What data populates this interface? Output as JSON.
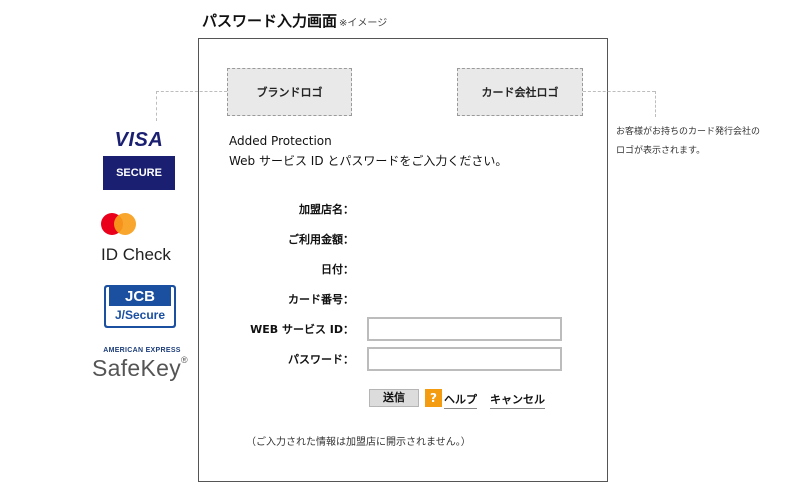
{
  "header": {
    "title": "パスワード入力画面",
    "note": "※イメージ"
  },
  "logo_placeholders": {
    "brand": "ブランドロゴ",
    "card_company": "カード会社ロゴ"
  },
  "side_note": {
    "line1": "お客様がお持ちのカード発行会社の",
    "line2": "ロゴが表示されます。"
  },
  "brand_logos": {
    "visa": {
      "word": "VISA",
      "sub": "SECURE"
    },
    "mastercard": {
      "text": "ID Check"
    },
    "jcb": {
      "word": "JCB",
      "sub": "J/Secure"
    },
    "amex": {
      "top": "AMERICAN EXPRESS",
      "main": "SafeKey",
      "mark": "®"
    }
  },
  "form": {
    "intro_line1": "Added Protection",
    "intro_line2": "Web サービス ID とパスワードをご入力ください。",
    "fields": {
      "merchant": "加盟店名：",
      "amount": "ご利用金額：",
      "date": "日付：",
      "card_number": "カード番号：",
      "web_service_id": "WEB サービス ID：",
      "password": "パスワード："
    },
    "web_service_id_value": "",
    "password_value": "",
    "buttons": {
      "send": "送信",
      "help_icon": "?",
      "help": "ヘルプ",
      "cancel": "キャンセル"
    },
    "footnote": "（ご入力された情報は加盟店に開示されません。）"
  },
  "colors": {
    "visa_blue": "#1a1f71",
    "jcb_blue": "#1b4fa0",
    "mc_red": "#eb001b",
    "mc_orange": "#f79e1b",
    "help_orange": "#f39c12"
  }
}
